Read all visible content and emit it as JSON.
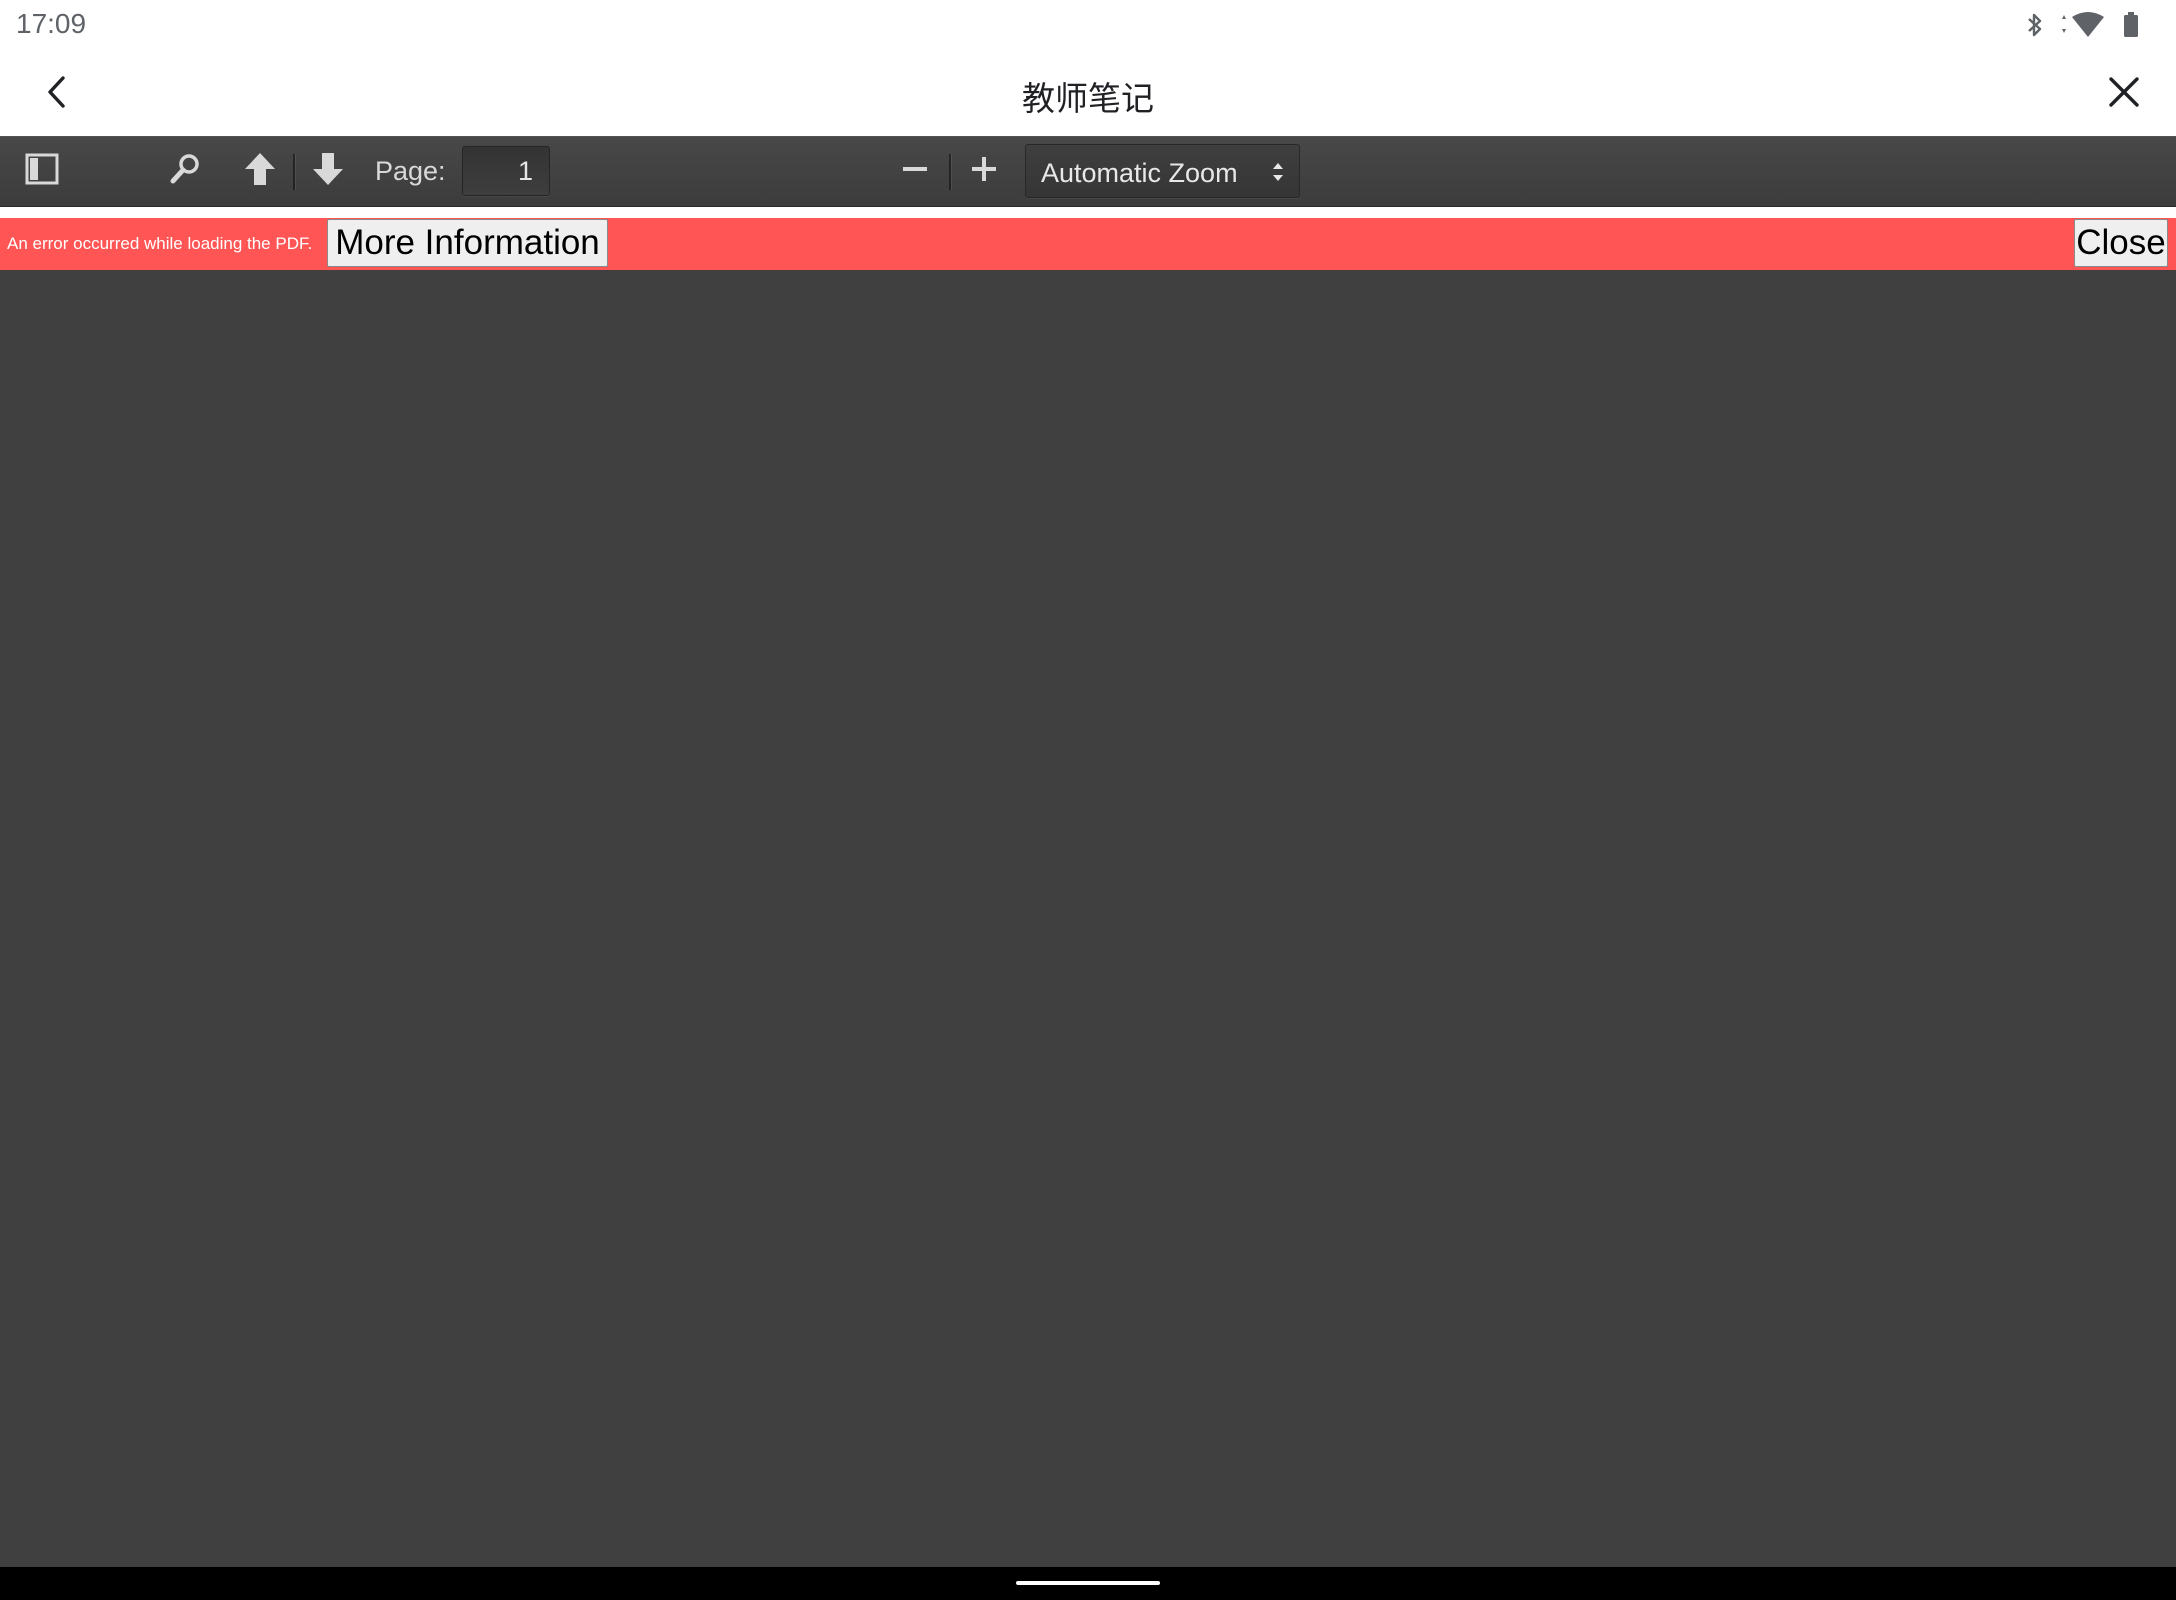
{
  "status_bar": {
    "time": "17:09",
    "icons": [
      "bluetooth-icon",
      "wifi-icon",
      "battery-icon"
    ]
  },
  "app_bar": {
    "title": "教师笔记",
    "back_icon": "chevron-left-icon",
    "close_icon": "close-icon"
  },
  "pdf_toolbar": {
    "sidebar_toggle_icon": "sidebar-toggle-icon",
    "search_icon": "search-icon",
    "previous_page_icon": "arrow-up-icon",
    "next_page_icon": "arrow-down-icon",
    "page_label": "Page:",
    "page_number": "1",
    "zoom_out_icon": "minus-icon",
    "zoom_in_icon": "plus-icon",
    "zoom_value": "Automatic Zoom"
  },
  "error_bar": {
    "message": "An error occurred while loading the PDF.",
    "more_info_label": "More Information",
    "close_label": "Close",
    "color": "#ff5555"
  },
  "colors": {
    "toolbar_bg": "#474747",
    "viewer_bg": "#404040",
    "error_bg": "#ff5555"
  }
}
